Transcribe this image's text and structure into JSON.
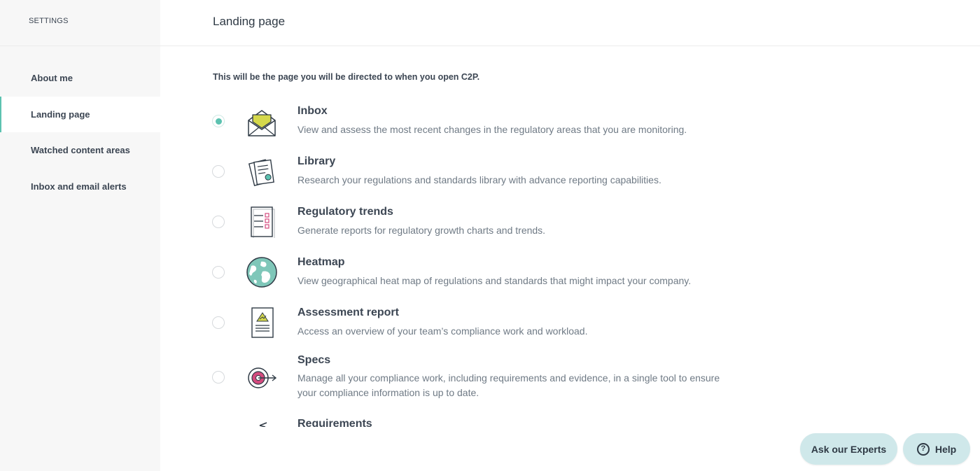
{
  "sidebar": {
    "title": "SETTINGS",
    "items": [
      {
        "label": "About me"
      },
      {
        "label": "Landing page"
      },
      {
        "label": "Watched content areas"
      },
      {
        "label": "Inbox and email alerts"
      }
    ],
    "active_index": 1
  },
  "header": {
    "title": "Landing page"
  },
  "main": {
    "intro": "This will be the page you will be directed to when you open C2P.",
    "selected": "Inbox",
    "options": [
      {
        "title": "Inbox",
        "description": "View and assess the most recent changes in the regulatory areas that you are monitoring.",
        "icon": "envelope-icon"
      },
      {
        "title": "Library",
        "description": "Research your regulations and standards library with advance reporting capabilities.",
        "icon": "documents-icon"
      },
      {
        "title": "Regulatory trends",
        "description": "Generate reports for regulatory growth charts and trends.",
        "icon": "checklist-icon"
      },
      {
        "title": "Heatmap",
        "description": "View geographical heat map of regulations and standards that might impact your company.",
        "icon": "globe-icon"
      },
      {
        "title": "Assessment report",
        "description": "Access an overview of your team’s compliance work and workload.",
        "icon": "report-icon"
      },
      {
        "title": "Specs",
        "description": "Manage all your compliance work, including requirements and evidence, in a single tool to ensure your compliance information is up to date.",
        "icon": "target-icon"
      },
      {
        "title": "Requirements",
        "description": "",
        "icon": "requirements-icon"
      }
    ]
  },
  "buttons": {
    "ask_experts": "Ask our Experts",
    "help": "Help",
    "help_icon": "question-icon"
  },
  "colors": {
    "accent": "#5cc2b0",
    "button_bg": "#cfe8ea",
    "sidebar_bg": "#f7f7f7"
  }
}
